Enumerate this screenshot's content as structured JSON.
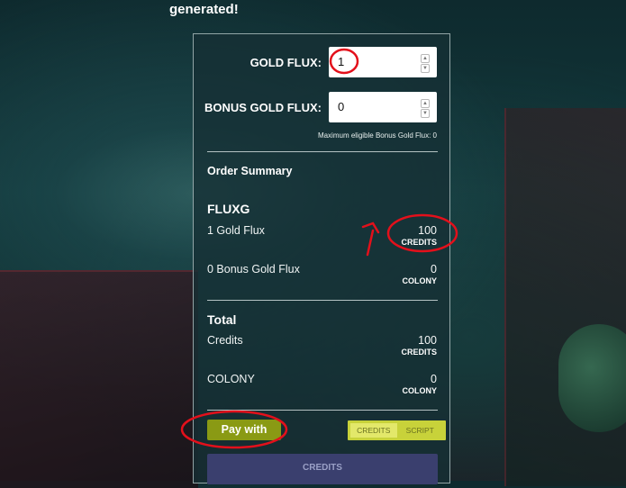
{
  "heading": "generated!",
  "form": {
    "gold_flux_label": "GOLD FLUX:",
    "gold_flux_value": "1",
    "bonus_label": "BONUS GOLD FLUX:",
    "bonus_value": "0",
    "bonus_note": "Maximum eligible Bonus Gold Flux: 0"
  },
  "summary": {
    "title": "Order Summary",
    "product": "FLUXG",
    "lines": [
      {
        "label": "1 Gold Flux",
        "value": "100",
        "unit": "CREDITS"
      },
      {
        "label": "0 Bonus Gold Flux",
        "value": "0",
        "unit": "COLONY"
      }
    ]
  },
  "total": {
    "title": "Total",
    "lines": [
      {
        "label": "Credits",
        "value": "100",
        "unit": "CREDITS"
      },
      {
        "label": "COLONY",
        "value": "0",
        "unit": "COLONY"
      }
    ]
  },
  "payment": {
    "pay_with_label": "Pay with",
    "options": [
      "CREDITS",
      "SCRIPT"
    ],
    "selected": "CREDITS",
    "pay_button_label": "CREDITS"
  },
  "colors": {
    "accent_olive": "#8a9a14",
    "toggle_yellow": "#c8d23a",
    "pay_button": "#3a3f6e",
    "annotation_red": "#e3101b"
  },
  "icons": [
    "spinner-up-icon",
    "spinner-down-icon",
    "annotation-arrow-icon"
  ]
}
